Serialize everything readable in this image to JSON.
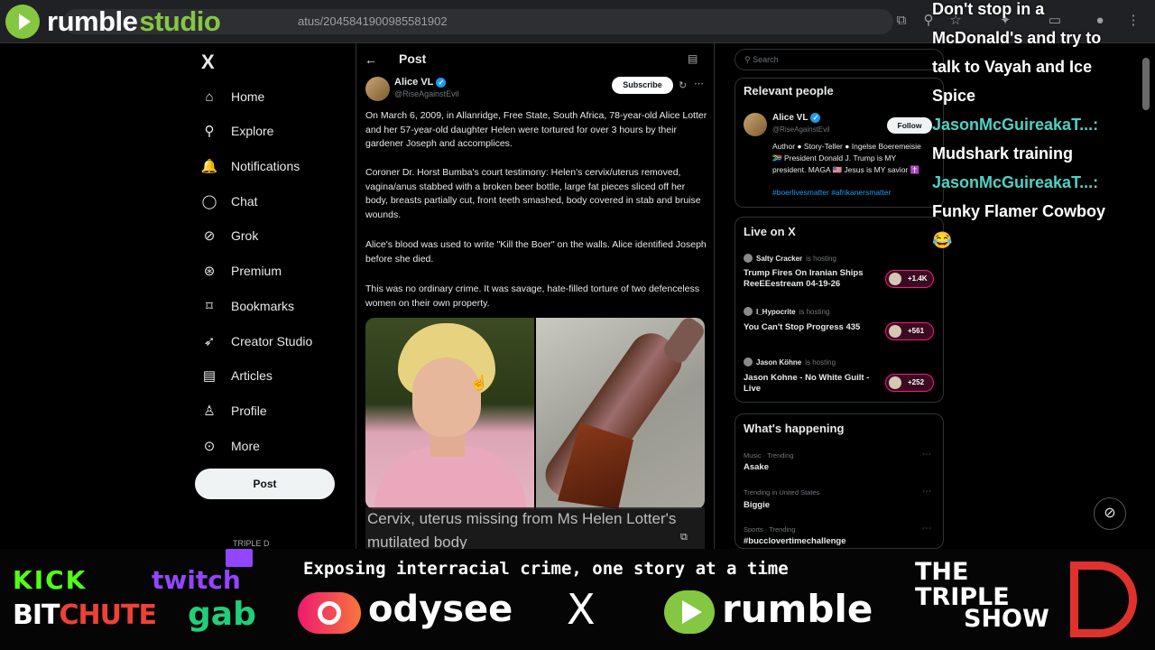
{
  "browser": {
    "url_visible": "atus/2045841900985581902",
    "watermark_word1": "rumble",
    "watermark_word2": "studio"
  },
  "sidebar": {
    "logo": "X",
    "items": [
      {
        "label": "Home",
        "icon": "home-icon",
        "glyph": "⌂"
      },
      {
        "label": "Explore",
        "icon": "search-icon",
        "glyph": "⚲"
      },
      {
        "label": "Notifications",
        "icon": "bell-icon",
        "glyph": "🔔"
      },
      {
        "label": "Chat",
        "icon": "chat-icon",
        "glyph": "◯"
      },
      {
        "label": "Grok",
        "icon": "grok-icon",
        "glyph": "⊘"
      },
      {
        "label": "Premium",
        "icon": "premium-icon",
        "glyph": "⊛"
      },
      {
        "label": "Bookmarks",
        "icon": "bookmark-icon",
        "glyph": "⌑"
      },
      {
        "label": "Creator Studio",
        "icon": "rocket-icon",
        "glyph": "➶"
      },
      {
        "label": "Articles",
        "icon": "articles-icon",
        "glyph": "▤"
      },
      {
        "label": "Profile",
        "icon": "profile-icon",
        "glyph": "♙"
      },
      {
        "label": "More",
        "icon": "more-icon",
        "glyph": "⊙"
      }
    ],
    "post_button": "Post",
    "account_handle": "TRIPLE D"
  },
  "post": {
    "header": "Post",
    "author_name": "Alice VL",
    "author_handle": "@RiseAgainstEvil",
    "subscribe": "Subscribe",
    "paragraphs": [
      "On March 6, 2009, in Allanridge, Free State, South Africa, 78-year-old Alice Lotter and her 57-year-old daughter Helen were tortured for over 3 hours by their gardener Joseph and accomplices.",
      "Coroner Dr. Horst Bumba's court testimony: Helen's cervix/uterus removed, vagina/anus stabbed with a broken beer bottle, large fat pieces sliced off her body, breasts partially cut, front teeth smashed, body covered in stab and bruise wounds.",
      "Alice's blood was used to write \"Kill the Boer\" on the walls. Alice identified Joseph before she died.",
      "This was no ordinary crime. It was savage, hate-filled torture of two defenceless women on their own property."
    ],
    "media_caption": "Cervix, uterus missing from Ms Helen Lotter's mutilated body"
  },
  "right": {
    "search_placeholder": "Search",
    "relevant_title": "Relevant people",
    "person": {
      "name": "Alice VL",
      "handle": "@RiseAgainstEvil",
      "follow": "Follow",
      "bio": "Author ● Story-Teller ● Ingelse Boeremeisie 🇿🇦 President Donald J. Trump is MY president. MAGA 🇺🇸 Jesus is MY savior ✝️",
      "tags": "#boerlivesmatter #afrikanersmatter"
    },
    "live_title": "Live on X",
    "live": [
      {
        "host": "Salty Cracker",
        "status": "is hosting",
        "title": "Trump Fires On Iranian Ships ReeEEestream 04-19-26",
        "count": "+1.4K"
      },
      {
        "host": "I_Hypocrite",
        "status": "is hosting",
        "title": "You Can't Stop Progress 435",
        "count": "+561"
      },
      {
        "host": "Jason Köhne",
        "status": "is hosting",
        "title": "Jason Kohne - No White Guilt - Live",
        "count": "+252"
      }
    ],
    "happening_title": "What's happening",
    "trends": [
      {
        "meta": "Music · Trending",
        "name": "Asake"
      },
      {
        "meta": "Trending in United States",
        "name": "Biggie"
      },
      {
        "meta": "Sports · Trending",
        "name": "#bucclovertimechallenge"
      }
    ]
  },
  "chat": [
    {
      "user": "",
      "text": "Don't stop in a"
    },
    {
      "user": "",
      "text": "McDonald's and try to"
    },
    {
      "user": "",
      "text": "talk to Vayah and Ice"
    },
    {
      "user": "",
      "text": "Spice"
    },
    {
      "user": "JasonMcGuireakaT...:",
      "text": ""
    },
    {
      "user": "",
      "text": "Mudshark training"
    },
    {
      "user": "JasonMcGuireakaT...:",
      "text": ""
    },
    {
      "user": "",
      "text": "Funky Flamer Cowboy"
    },
    {
      "user": "",
      "text": "😂"
    }
  ],
  "banner": {
    "tagline": "Exposing interracial crime, one story at a time",
    "kick": "KICK",
    "twitch": "twitch",
    "bit": "BIT",
    "chute": "CHUTE",
    "gab": "gab",
    "odysee": "odysee",
    "x": "X",
    "rumble": "rumble",
    "show_the": "THE",
    "show_triple": "TRIPLE",
    "show_show": "SHOW"
  },
  "colors": {
    "rumble_green": "#85c742",
    "x_blue": "#1d9bf0",
    "live_pink": "#f91880",
    "chat_user": "#4fd1c5"
  }
}
